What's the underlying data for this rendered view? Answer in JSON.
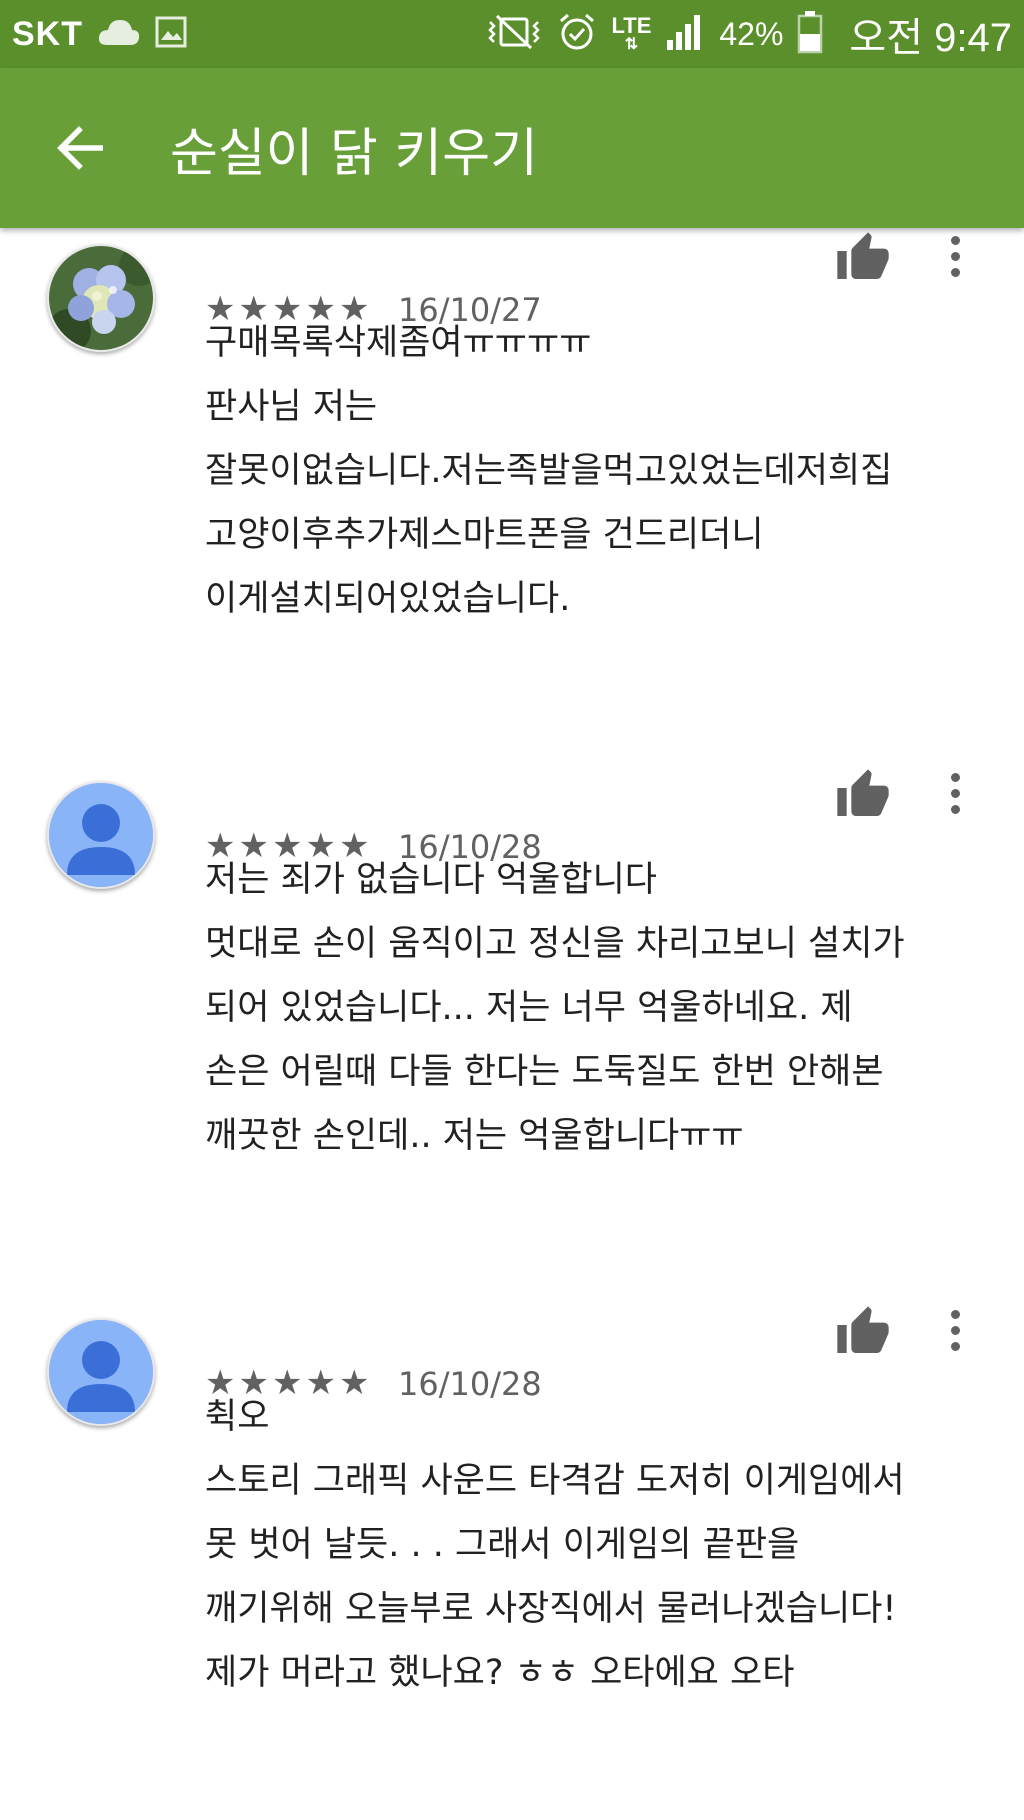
{
  "status_bar": {
    "carrier": "SKT",
    "network": "LTE",
    "battery_percent": "42%",
    "time": "오전 9:47",
    "icons": [
      "cloud-icon",
      "image-icon",
      "vibrate-mute-icon",
      "alarm-icon",
      "lte-icon",
      "signal-icon",
      "battery-icon"
    ]
  },
  "app_bar": {
    "title": "순실이 닭 키우기",
    "back_icon": "arrow-back-icon",
    "color": "#689f38"
  },
  "reviews": [
    {
      "avatar": "flower-photo",
      "rating": 5,
      "stars": "★★★★★",
      "date": "16/10/27",
      "lines": [
        "구매목록삭제좀여ㅠㅠㅠㅠ",
        "판사님 저는",
        "잘못이없습니다.저는족발을먹고있었는데저희집",
        "고양이후추가제스마트폰을 건드리더니",
        "이게설치되어있었습니다."
      ]
    },
    {
      "avatar": "default-person",
      "rating": 5,
      "stars": "★★★★★",
      "date": "16/10/28",
      "lines": [
        "저는 죄가 없습니다 억울합니다",
        "멋대로 손이 움직이고 정신을 차리고보니 설치가",
        "되어 있었습니다... 저는 너무 억울하네요. 제",
        "손은 어릴때 다들 한다는 도둑질도 한번 안해본",
        "깨끗한 손인데.. 저는 억울합니다ㅠㅠ"
      ]
    },
    {
      "avatar": "default-person",
      "rating": 5,
      "stars": "★★★★★",
      "date": "16/10/28",
      "lines": [
        "췩오",
        "스토리 그래픽 사운드 타격감 도저히 이게임에서",
        "못 벗어 날듯. . . 그래서 이게임의 끝판을",
        "깨기위해 오늘부로 사장직에서 물러나겠습니다!",
        "제가 머라고 했나요? ㅎㅎ 오타에요 오타"
      ]
    }
  ]
}
